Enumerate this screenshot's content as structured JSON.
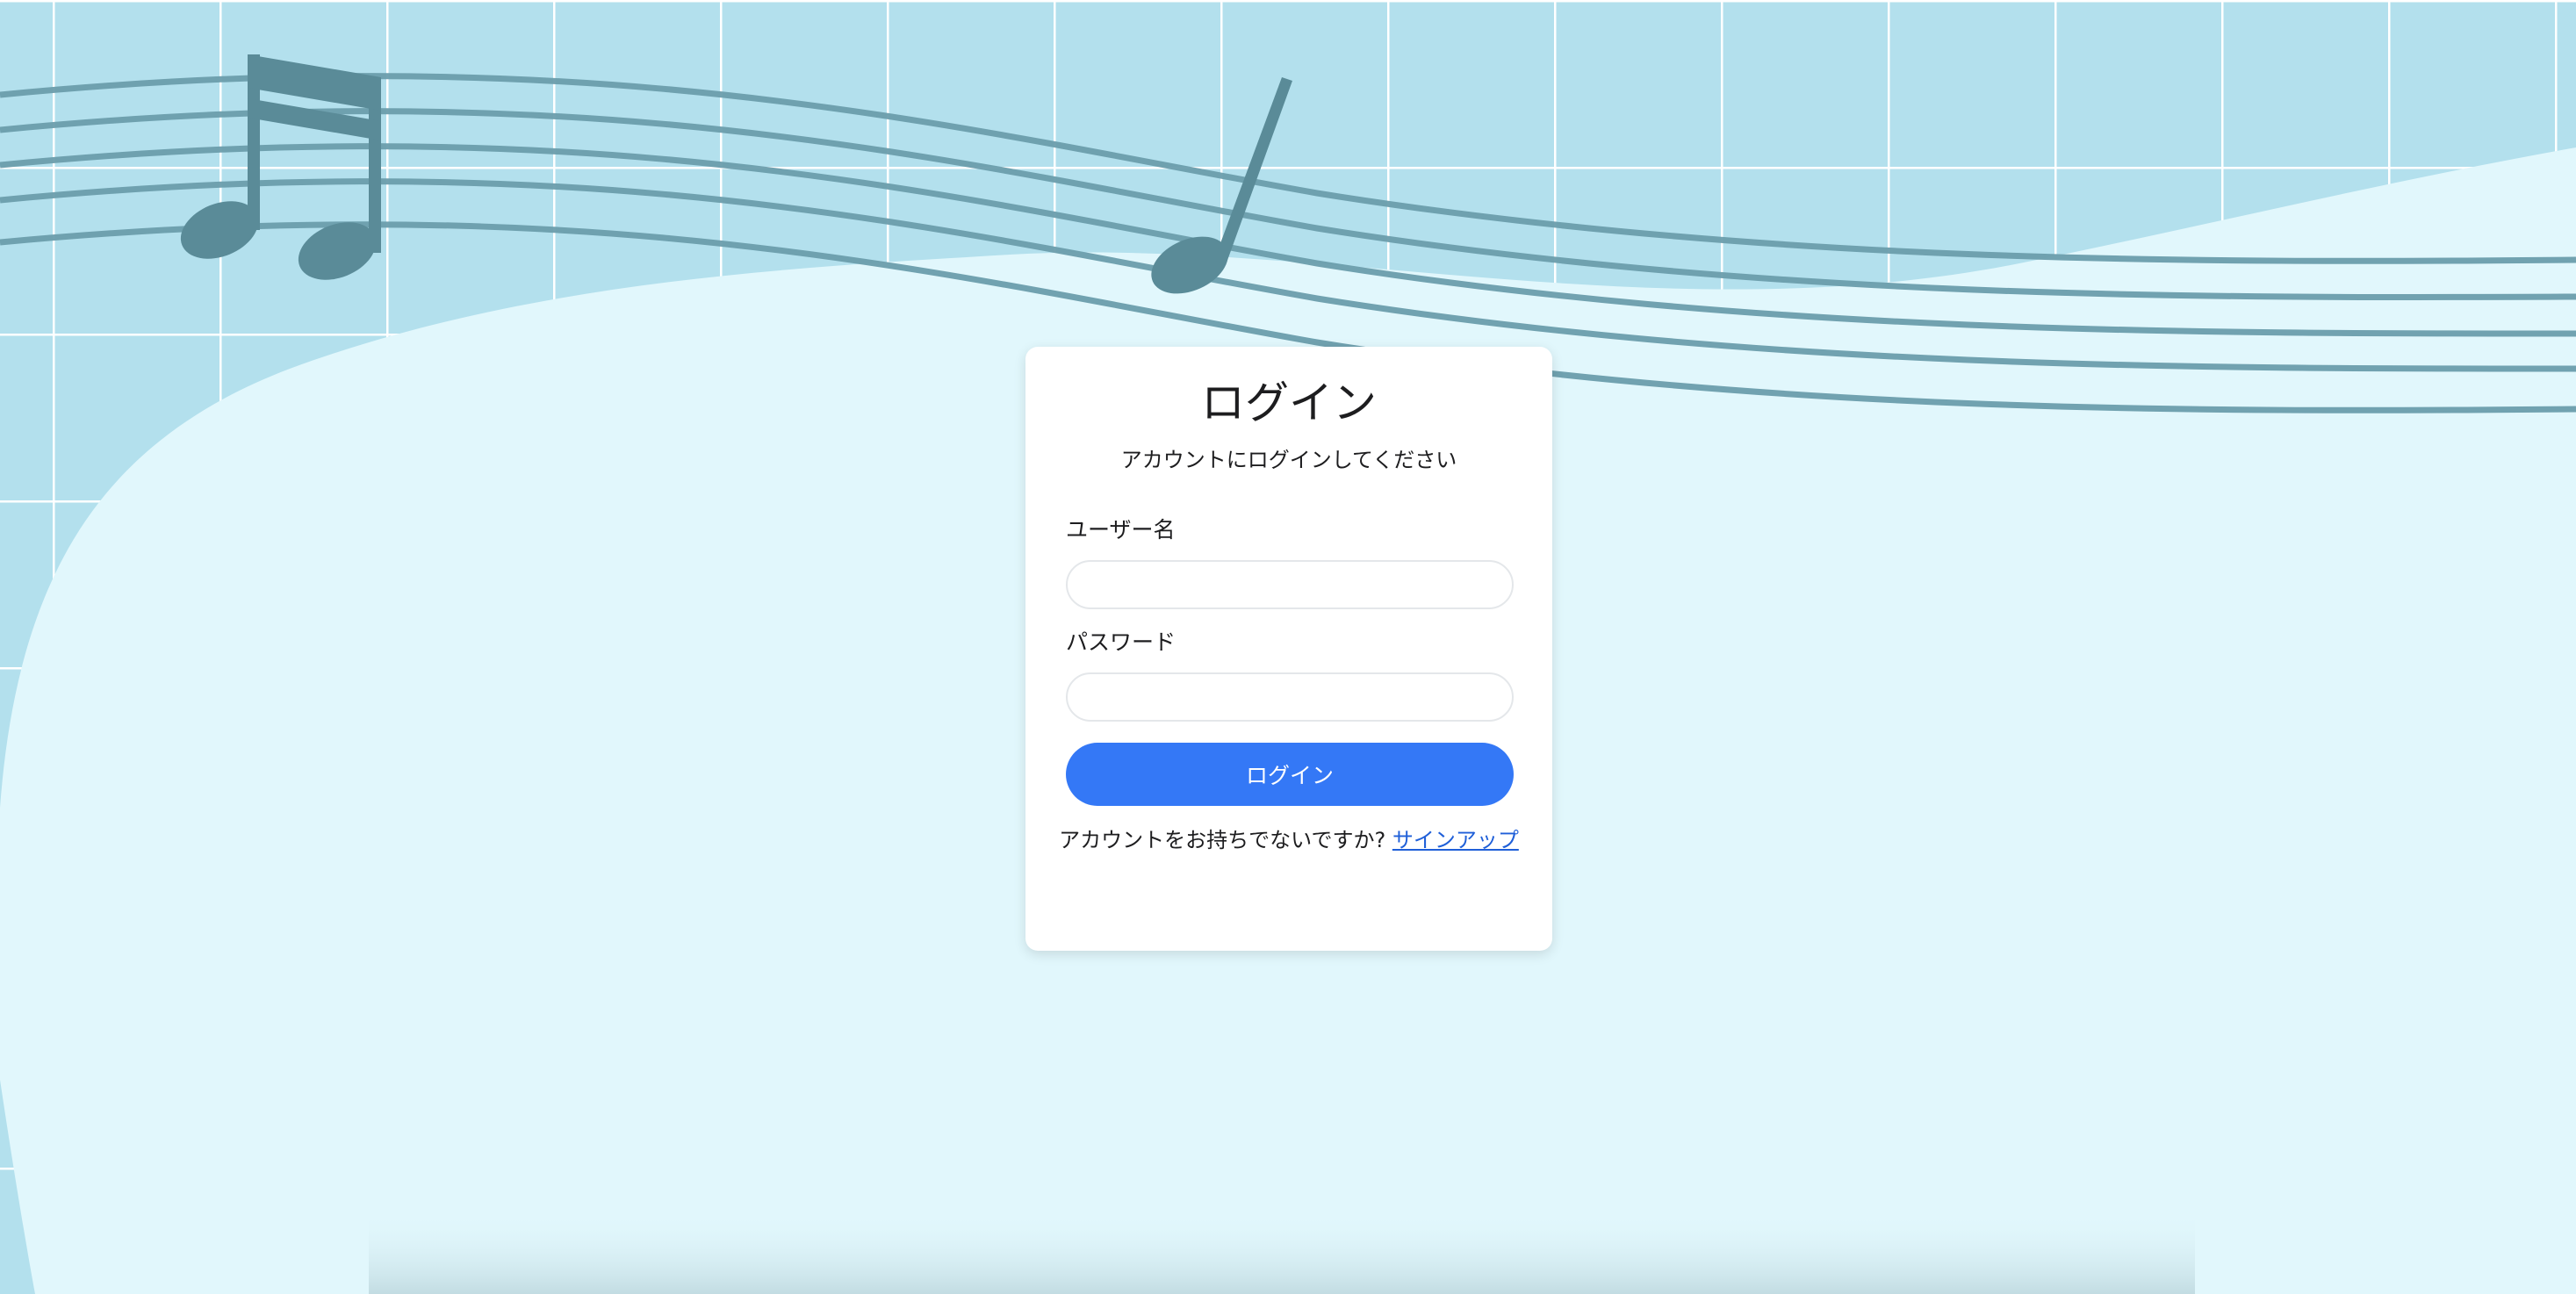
{
  "login": {
    "title": "ログイン",
    "subtitle": "アカウントにログインしてください",
    "username_label": "ユーザー名",
    "username_value": "",
    "password_label": "パスワード",
    "password_value": "",
    "submit_label": "ログイン",
    "signup_prompt": "アカウントをお持ちでないですか? ",
    "signup_link": "サインアップ"
  },
  "decor": {
    "icons": [
      "eighth-notes-icon",
      "quarter-note-icon",
      "music-staff"
    ],
    "colors": {
      "background": "#e1f7fc",
      "grid_tile": "#b3e0ed",
      "staff": "#6c9eac",
      "note": "#5a8b98",
      "accent": "#3478f6"
    }
  }
}
